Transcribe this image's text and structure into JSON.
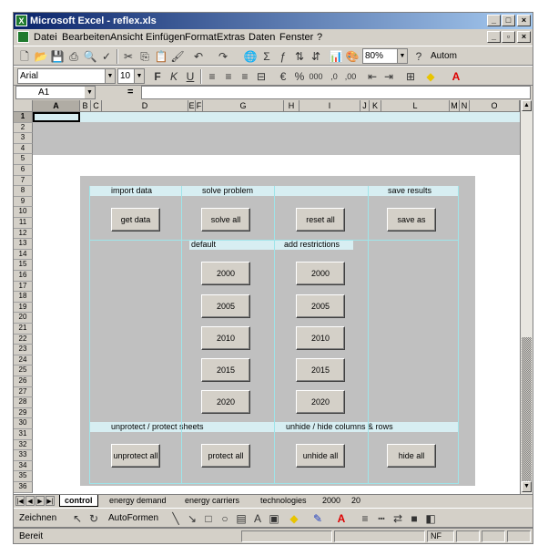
{
  "window": {
    "title": "Microsoft Excel - reflex.xls"
  },
  "menu": [
    "Datei",
    "Bearbeiten",
    "Ansicht",
    "Einfügen",
    "Format",
    "Extras",
    "Daten",
    "Fenster",
    "?"
  ],
  "toolbar": {
    "zoom": "80%",
    "autoformen": "Autom",
    "font": "Arial",
    "size": "10"
  },
  "namebox": "A1",
  "formula_eq": "=",
  "columns": [
    "A",
    "B",
    "C",
    "D",
    "E",
    "F",
    "G",
    "H",
    "I",
    "J",
    "K",
    "L",
    "M",
    "N",
    "O"
  ],
  "rows": [
    "1",
    "2",
    "3",
    "4",
    "5",
    "6",
    "7",
    "8",
    "9",
    "10",
    "11",
    "12",
    "13",
    "14",
    "15",
    "16",
    "17",
    "18",
    "19",
    "20",
    "21",
    "22",
    "23",
    "24",
    "25",
    "26",
    "27",
    "28",
    "29",
    "30",
    "31",
    "32",
    "33",
    "34",
    "35",
    "36"
  ],
  "panel": {
    "import_label": "import data",
    "solve_label": "solve problem",
    "save_label": "save results",
    "get_data": "get data",
    "solve_all": "solve all",
    "reset_all": "reset all",
    "save_as": "save as",
    "default_label": "default",
    "restrictions_label": "add restrictions",
    "years": [
      "2000",
      "2005",
      "2010",
      "2015",
      "2020"
    ],
    "protect_label": "unprotect / protect sheets",
    "hide_label": "unhide / hide columns & rows",
    "unprotect_all": "unprotect all",
    "protect_all": "protect all",
    "unhide_all": "unhide all",
    "hide_all": "hide all"
  },
  "tabs": [
    "control",
    "energy demand",
    "energy carriers",
    "technologies",
    "2000",
    "20"
  ],
  "drawing": {
    "zeichnen": "Zeichnen",
    "autoformen": "AutoFormen"
  },
  "status": {
    "text": "Bereit",
    "nf": "NF"
  },
  "colors": {
    "title": "#0a246a",
    "band": "#d7eef2",
    "panel": "#c0c0c0"
  }
}
